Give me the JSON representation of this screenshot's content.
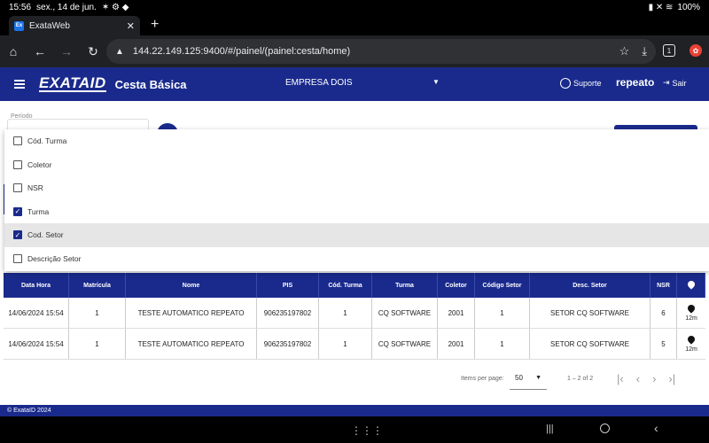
{
  "status_bar": {
    "time": "15:56",
    "date": "sex., 14 de jun.",
    "battery": "100%"
  },
  "browser": {
    "tab_title": "ExataWeb",
    "tab_favicon": "Ex",
    "url": "144.22.149.125:9400/#/painel/(painel:cesta/home)",
    "tab_count": "1"
  },
  "app_header": {
    "logo": "EXATAID",
    "module": "Cesta Básica",
    "company": "EMPRESA DOIS",
    "support": "Suporte",
    "user": "repeato",
    "logout": "Sair"
  },
  "filters": {
    "period_label": "Período"
  },
  "column_picker": {
    "items": [
      {
        "label": "Cód. Turma",
        "checked": false
      },
      {
        "label": "Coletor",
        "checked": false
      },
      {
        "label": "NSR",
        "checked": false
      },
      {
        "label": "Turma",
        "checked": true
      },
      {
        "label": "Cod. Setor",
        "checked": true
      },
      {
        "label": "Descrição Setor",
        "checked": false
      }
    ]
  },
  "table": {
    "headers": [
      "Data Hora",
      "Matrícula",
      "Nome",
      "PIS",
      "Cód. Turma",
      "Turma",
      "Coletor",
      "Código Setor",
      "Desc. Setor",
      "NSR"
    ],
    "rows": [
      {
        "data_hora": "14/06/2024 15:54",
        "matricula": "1",
        "nome": "TESTE AUTOMATICO REPEATO",
        "pis": "906235197802",
        "cod_turma": "1",
        "turma": "CQ SOFTWARE",
        "coletor": "2001",
        "codigo_setor": "1",
        "desc_setor": "SETOR CQ SOFTWARE",
        "nsr": "6",
        "location": "12m"
      },
      {
        "data_hora": "14/06/2024 15:54",
        "matricula": "1",
        "nome": "TESTE AUTOMATICO REPEATO",
        "pis": "906235197802",
        "cod_turma": "1",
        "turma": "CQ SOFTWARE",
        "coletor": "2001",
        "codigo_setor": "1",
        "desc_setor": "SETOR CQ SOFTWARE",
        "nsr": "5",
        "location": "12m"
      }
    ]
  },
  "paginator": {
    "items_per_page_label": "Items per page:",
    "items_per_page": "50",
    "range": "1 – 2 of 2"
  },
  "footer": {
    "copyright": "© ExataID 2024"
  },
  "colors": {
    "brand_primary": "#1a2a8c",
    "row_highlight": "#e6e6e6"
  }
}
